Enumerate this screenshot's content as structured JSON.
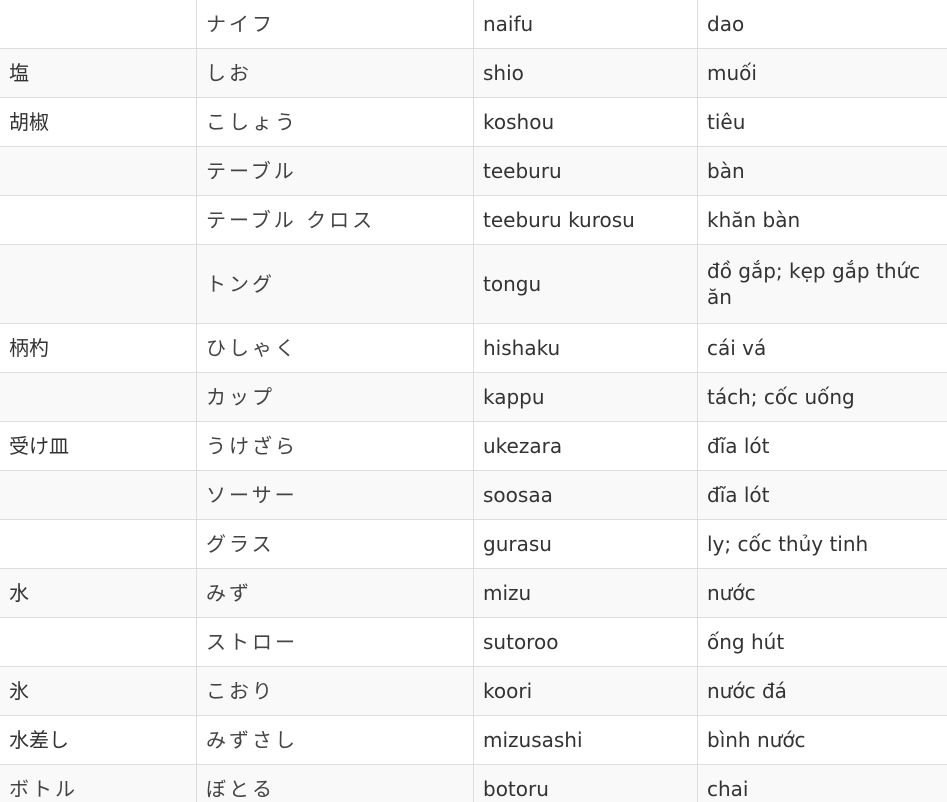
{
  "vocabulary": {
    "rows": [
      {
        "kanji": "",
        "kana": "ナイフ",
        "romaji": "naifu",
        "meaning": "dao"
      },
      {
        "kanji": "塩",
        "kana": "しお",
        "romaji": "shio",
        "meaning": "muối"
      },
      {
        "kanji": "胡椒",
        "kana": "こしょう",
        "romaji": "koshou",
        "meaning": "tiêu"
      },
      {
        "kanji": "",
        "kana": "テーブル",
        "romaji": "teeburu",
        "meaning": "bàn"
      },
      {
        "kanji": "",
        "kana": "テーブル クロス",
        "romaji": "teeburu kurosu",
        "meaning": "khăn bàn"
      },
      {
        "kanji": "",
        "kana": "トング",
        "romaji": "tongu",
        "meaning": "đồ gắp; kẹp gắp thức ăn"
      },
      {
        "kanji": "柄杓",
        "kana": "ひしゃく",
        "romaji": "hishaku",
        "meaning": "cái vá"
      },
      {
        "kanji": "",
        "kana": "カップ",
        "romaji": "kappu",
        "meaning": "tách; cốc uống"
      },
      {
        "kanji": "受け皿",
        "kana": "うけざら",
        "romaji": "ukezara",
        "meaning": " đĩa lót"
      },
      {
        "kanji": "",
        "kana": "ソーサー",
        "romaji": "soosaa",
        "meaning": " đĩa lót"
      },
      {
        "kanji": "",
        "kana": "グラス",
        "romaji": "gurasu",
        "meaning": "ly; cốc thủy tinh"
      },
      {
        "kanji": "水",
        "kana": "みず",
        "romaji": "mizu",
        "meaning": "nước"
      },
      {
        "kanji": "",
        "kana": "ストロー",
        "romaji": "sutoroo",
        "meaning": "ống hút"
      },
      {
        "kanji": "氷",
        "kana": "こおり",
        "romaji": "koori",
        "meaning": "nước đá"
      },
      {
        "kanji": "水差し",
        "kana": "みずさし",
        "romaji": "mizusashi",
        "meaning": "bình nước"
      },
      {
        "kanji": "ボトル",
        "kana": "ぼとる",
        "romaji": "botoru",
        "meaning": "chai"
      }
    ]
  }
}
